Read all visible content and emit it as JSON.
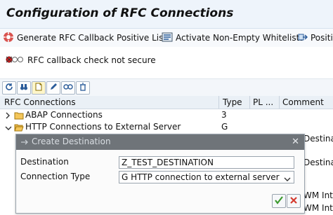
{
  "header": {
    "title": "Configuration of RFC Connections"
  },
  "toolbar": {
    "generate_label": "Generate RFC Callback Positive Lists",
    "activate_label": "Activate Non-Empty Whitelists",
    "positive_label": "Positiv"
  },
  "status": {
    "text": "RFC callback check not secure"
  },
  "table": {
    "headers": {
      "name": "RFC Connections",
      "type": "Type",
      "pl": "PL ...",
      "comment": "Comment"
    },
    "rows": [
      {
        "label": "ABAP Connections",
        "type": "3"
      },
      {
        "label": "HTTP Connections to External Server",
        "type": "G"
      }
    ]
  },
  "side_texts": [
    "Destinat",
    "Destinat",
    "WM Inte",
    "WM Inte"
  ],
  "dialog": {
    "title": "Create Destination",
    "destination_label": "Destination",
    "destination_value": "Z_TEST_DESTINATION",
    "connection_type_label": "Connection Type",
    "connection_type_value": "G HTTP connection to external server"
  }
}
